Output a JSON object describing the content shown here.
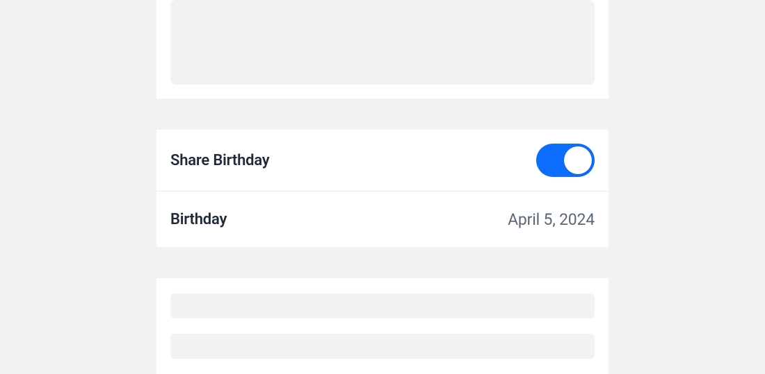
{
  "birthday_section": {
    "share_label": "Share Birthday",
    "share_enabled": true,
    "birthday_label": "Birthday",
    "birthday_value": "April 5, 2024"
  }
}
